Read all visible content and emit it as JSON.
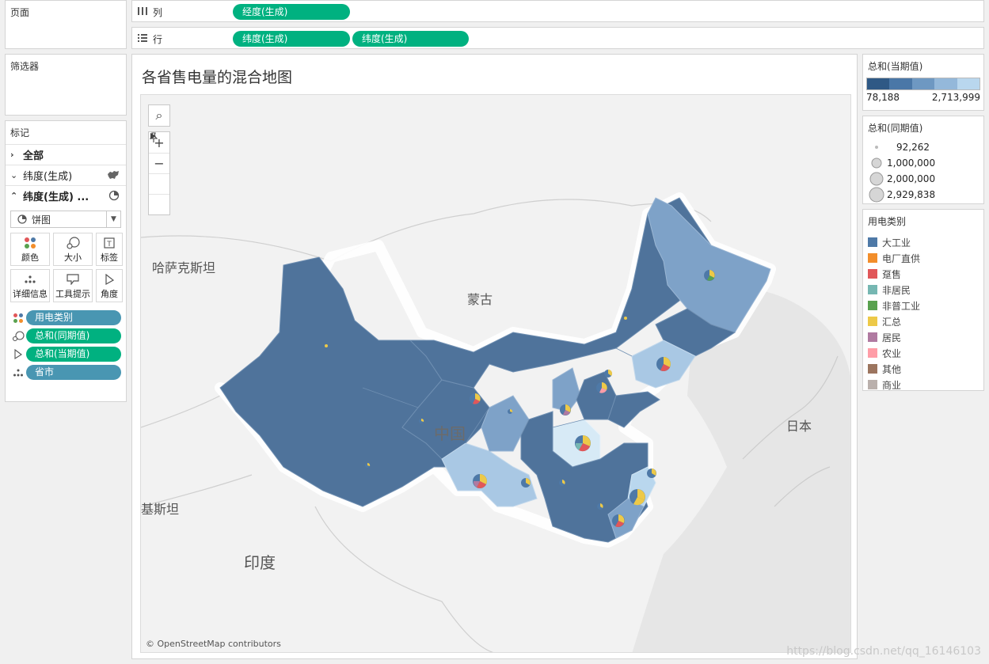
{
  "left": {
    "pages_title": "页面",
    "filters_title": "筛选器",
    "marks_title": "标记",
    "rows": [
      {
        "label": "全部"
      },
      {
        "label": "纬度(生成)"
      },
      {
        "label": "纬度(生成) ..."
      }
    ],
    "mark_type": "饼图",
    "buttons": [
      "颜色",
      "大小",
      "标签",
      "详细信息",
      "工具提示",
      "角度"
    ],
    "pills": [
      {
        "label": "用电类别",
        "kind": "color"
      },
      {
        "label": "总和(同期值)",
        "kind": "size"
      },
      {
        "label": "总和(当期值)",
        "kind": "angle"
      },
      {
        "label": "省市",
        "kind": "detail"
      }
    ]
  },
  "shelves": {
    "columns_label": "列",
    "rows_label": "行",
    "columns_pills": [
      "经度(生成)"
    ],
    "rows_pills": [
      "纬度(生成)",
      "纬度(生成)"
    ]
  },
  "viz": {
    "title": "各省售电量的混合地图",
    "attribution": "© OpenStreetMap contributors",
    "labels": {
      "kazakhstan": "哈萨克斯坦",
      "mongolia": "蒙古",
      "china": "中国",
      "japan": "日本",
      "pakistan": "基斯坦",
      "india": "印度"
    }
  },
  "legends": {
    "color_title": "总和(当期值)",
    "color_min": "78,188",
    "color_max": "2,713,999",
    "color_ramp": [
      "#2f5985",
      "#4a77a7",
      "#6e98c2",
      "#94b8da",
      "#b9d7ee"
    ],
    "size_title": "总和(同期值)",
    "size_values": [
      "92,262",
      "1,000,000",
      "2,000,000",
      "2,929,838"
    ],
    "cat_title": "用电类别",
    "categories": [
      {
        "label": "大工业",
        "color": "#4e79a7"
      },
      {
        "label": "电厂直供",
        "color": "#f28e2b"
      },
      {
        "label": "趸售",
        "color": "#e15759"
      },
      {
        "label": "非居民",
        "color": "#76b7b2"
      },
      {
        "label": "非普工业",
        "color": "#59a14f"
      },
      {
        "label": "汇总",
        "color": "#edc948"
      },
      {
        "label": "居民",
        "color": "#b07aa1"
      },
      {
        "label": "农业",
        "color": "#ff9da7"
      },
      {
        "label": "其他",
        "color": "#9c755f"
      },
      {
        "label": "商业",
        "color": "#bab0ac"
      }
    ]
  },
  "watermark": "https://blog.csdn.net/qq_16146103"
}
